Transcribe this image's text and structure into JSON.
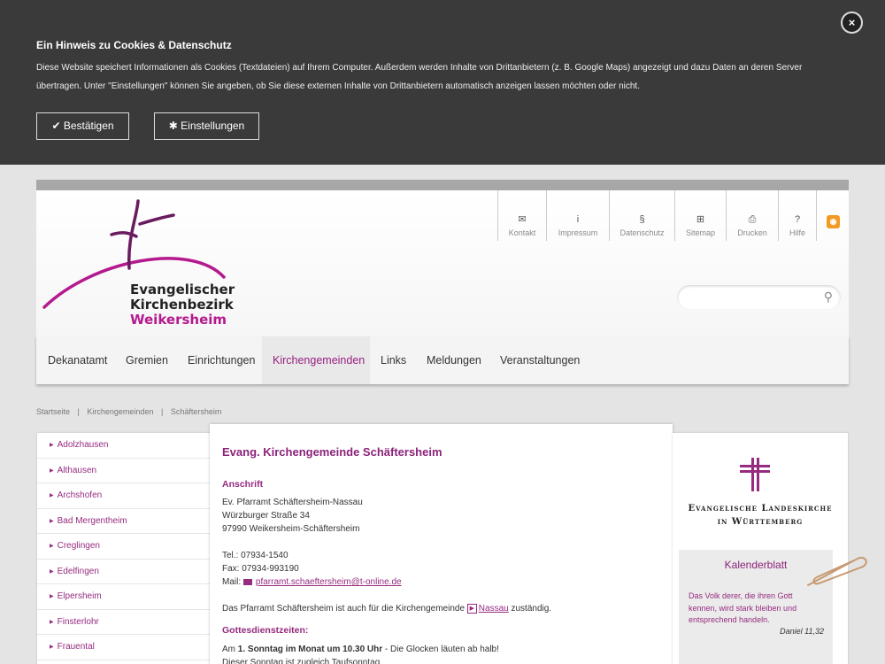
{
  "cookie": {
    "title": "Ein Hinweis zu Cookies & Datenschutz",
    "text": "Diese Website speichert Informationen als Cookies (Textdateien) auf Ihrem Computer. Außerdem werden Inhalte von Drittanbietern (z. B. Google Maps) angezeigt und dazu Daten an deren Server übertragen. Unter \"Einstellungen\" können Sie angeben, ob Sie diese externen Inhalte von Drittanbietern automatisch anzeigen lassen möchten oder nicht.",
    "confirm_label": "Bestätigen",
    "settings_label": "Einstellungen",
    "close_glyph": "×"
  },
  "logo": {
    "line1": "Evangelischer",
    "line2": "Kirchenbezirk",
    "line3": "Weikersheim"
  },
  "service_nav": [
    {
      "label": "Kontakt",
      "icon": "envelope-icon",
      "glyph": "✉"
    },
    {
      "label": "Impressum",
      "icon": "info-icon",
      "glyph": "i"
    },
    {
      "label": "Datenschutz",
      "icon": "paragraph-icon",
      "glyph": "§"
    },
    {
      "label": "Sitemap",
      "icon": "sitemap-icon",
      "glyph": "⊞"
    },
    {
      "label": "Drucken",
      "icon": "print-icon",
      "glyph": "⎙"
    },
    {
      "label": "Hilfe",
      "icon": "help-icon",
      "glyph": "?"
    }
  ],
  "search": {
    "placeholder": ""
  },
  "main_nav": [
    {
      "label": "Dekanatamt"
    },
    {
      "label": "Gremien"
    },
    {
      "label": "Einrichtungen"
    },
    {
      "label": "Kirchengemeinden",
      "active": true
    },
    {
      "label": "Links"
    },
    {
      "label": "Meldungen"
    },
    {
      "label": "Veranstaltungen"
    }
  ],
  "breadcrumb": [
    "Startseite",
    "|",
    "Kirchengemeinden",
    "|",
    "Schäftersheim"
  ],
  "left_menu": [
    "Adolzhausen",
    "Althausen",
    "Archshofen",
    "Bad Mergentheim",
    "Creglingen",
    "Edelfingen",
    "Elpersheim",
    "Finsterlohr",
    "Frauental"
  ],
  "content": {
    "title": "Evang. Kirchengemeinde Schäftersheim",
    "address_heading": "Anschrift",
    "address_lines": [
      "Ev. Pfarramt Schäftersheim-Nassau",
      "Würzburger Straße 34",
      "97990 Weikersheim-Schäftersheim"
    ],
    "tel": "Tel.: 07934-1540",
    "fax": "Fax: 07934-993190",
    "mail_label": "Mail:",
    "mail_link": "pfarramt.schaeftersheim@t-online.de",
    "responsible_pre": "Das Pfarramt Schäftersheim ist auch für die Kirchengemeinde",
    "responsible_link": "Nassau",
    "responsible_post": "zuständig.",
    "services_heading": "Gottesdienstzeiten:",
    "services_line1_pre": "Am",
    "services_line1_bold": "1. Sonntag im Monat um 10.30 Uhr",
    "services_line1_post": "- Die Glocken läuten ab halb!",
    "services_line2": "Dieser Sonntag ist zugleich Taufsonntag."
  },
  "sidebar": {
    "elk_line1": "Evangelische Landeskirche",
    "elk_line2": "in Württemberg",
    "kalender_title": "Kalenderblatt",
    "kalender_quote": "Das Volk derer, die ihren Gott kennen, wird stark bleiben und entsprechend handeln.",
    "kalender_ref": "Daniel 11,32"
  },
  "colors": {
    "brand": "#962b80",
    "banner": "#3a3a3a"
  }
}
